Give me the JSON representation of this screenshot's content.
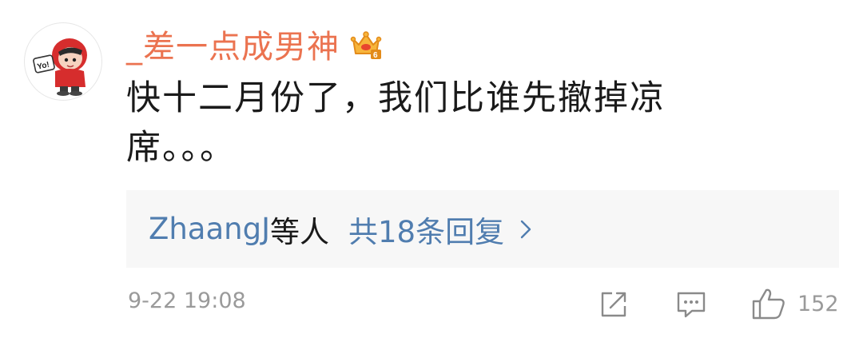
{
  "comment": {
    "username": "_差一点成男神",
    "text": "快十二月份了，我们比谁先撤掉凉席。。。",
    "avatar_icon": "cartoon-boy-avatar-icon",
    "badge_icon": "crown-member-badge-icon"
  },
  "replies": {
    "user": "ZhaangJ",
    "suffix": "等人",
    "count_text": "共18条回复",
    "chevron_icon": "chevron-right-icon"
  },
  "footer": {
    "timestamp": "9-22 19:08",
    "share_icon": "share-icon",
    "comment_icon": "comment-icon",
    "like_icon": "thumbs-up-icon",
    "like_count": "152"
  },
  "colors": {
    "username": "#eb7350",
    "link": "#507daf",
    "text": "#1a1a1a",
    "meta": "#9a9a9a",
    "reply_bg": "#f7f7f7"
  }
}
